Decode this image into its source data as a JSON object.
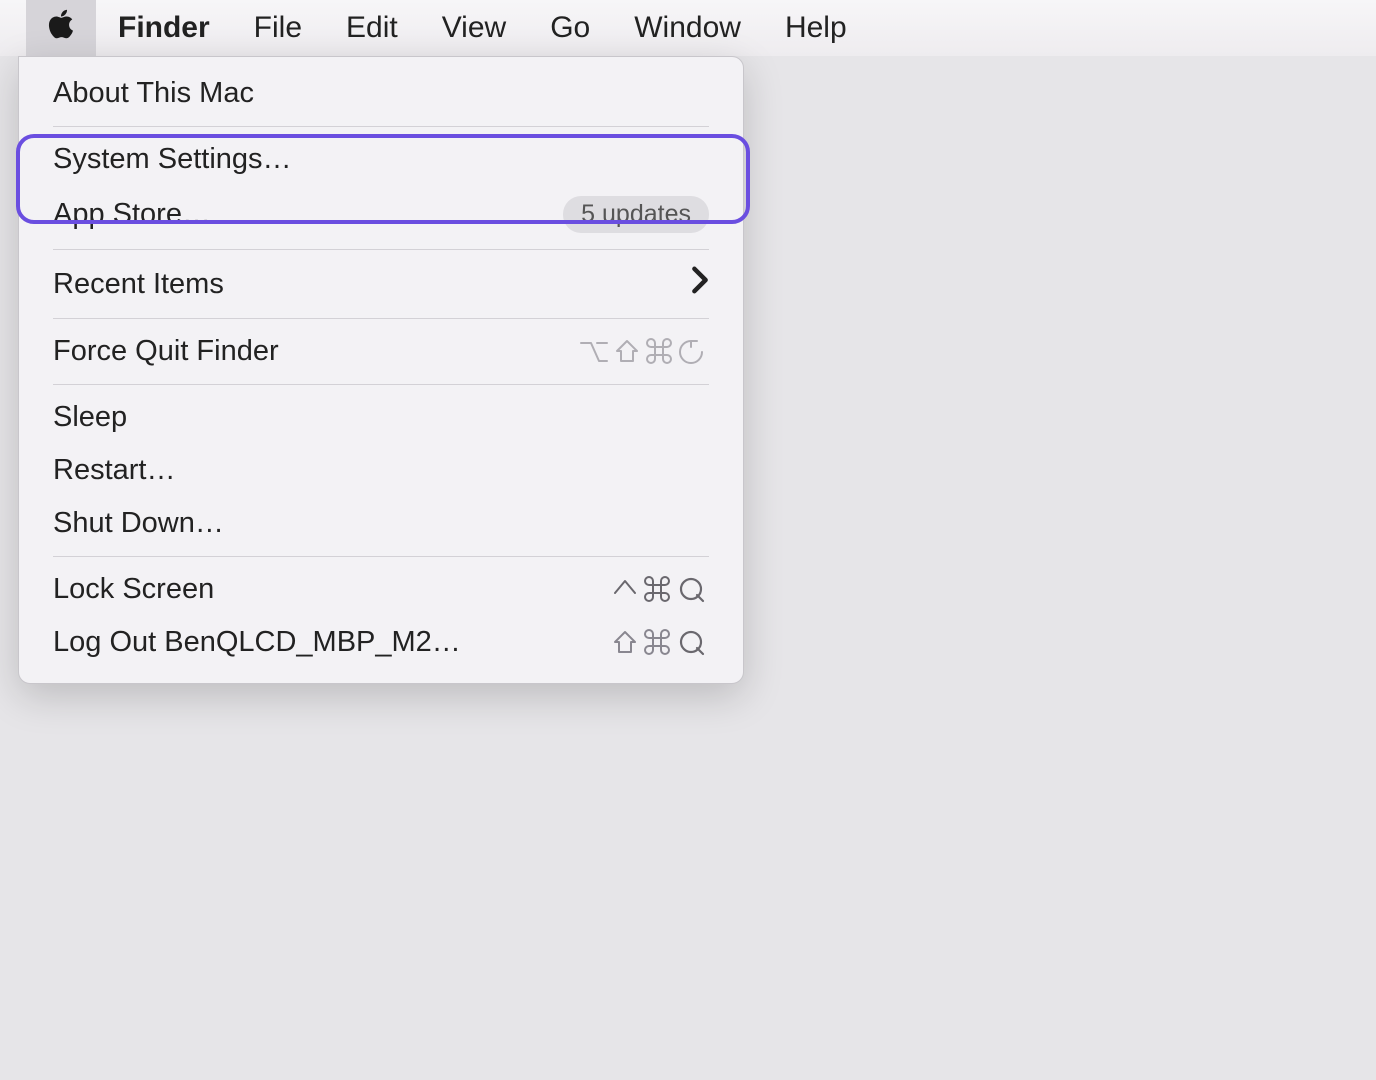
{
  "menubar": {
    "app_name": "Finder",
    "items": [
      "File",
      "Edit",
      "View",
      "Go",
      "Window",
      "Help"
    ]
  },
  "apple_menu": {
    "about": "About This Mac",
    "system_settings": "System Settings…",
    "app_store": "App Store…",
    "app_store_badge": "5 updates",
    "recent_items": "Recent Items",
    "force_quit": "Force Quit Finder",
    "force_quit_shortcut": "⌥⇧⌘⎋",
    "sleep": "Sleep",
    "restart": "Restart…",
    "shut_down": "Shut Down…",
    "lock_screen": "Lock Screen",
    "lock_screen_shortcut": "⌃⌘Q",
    "log_out": "Log Out BenQLCD_MBP_M2…",
    "log_out_shortcut": "⇧⌘Q"
  }
}
